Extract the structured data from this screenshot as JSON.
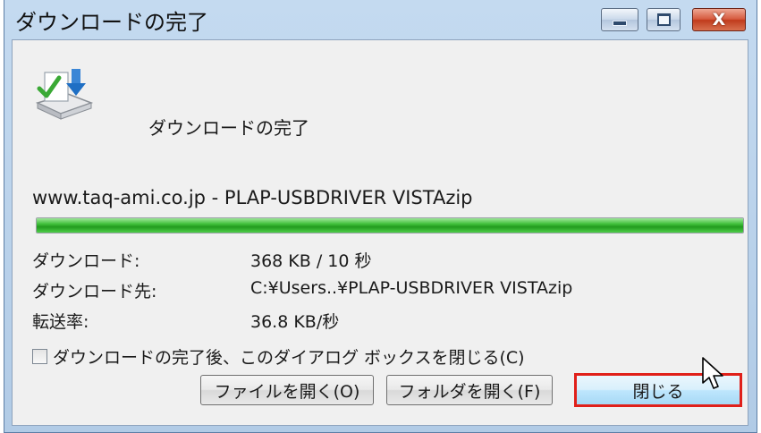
{
  "window": {
    "title": "ダウンロードの完了",
    "controls": {
      "minimize_icon": "minimize-icon",
      "maximize_icon": "maximize-icon",
      "close_glyph": "X"
    }
  },
  "dialog": {
    "icon": "download-complete-icon",
    "heading": "ダウンロードの完了",
    "filename": "www.taq-ami.co.jp - PLAP-USBDRIVER VISTAzip",
    "progress": 1.0,
    "details": {
      "downloaded_label": "ダウンロード:",
      "downloaded_value": "368 KB / 10 秒",
      "destination_label": "ダウンロード先:",
      "destination_value": "C:¥Users..¥PLAP-USBDRIVER VISTAzip",
      "rate_label": "転送率:",
      "rate_value": "36.8 KB/秒"
    },
    "checkbox_label": "ダウンロードの完了後、このダイアログ ボックスを閉じる(C)",
    "checkbox_checked": false,
    "buttons": {
      "open_file": "ファイルを開く(O)",
      "open_folder": "フォルダを開く(F)",
      "close": "閉じる"
    }
  },
  "colors": {
    "highlight_border": "#e0201a",
    "progress_green": "#229a1f"
  }
}
